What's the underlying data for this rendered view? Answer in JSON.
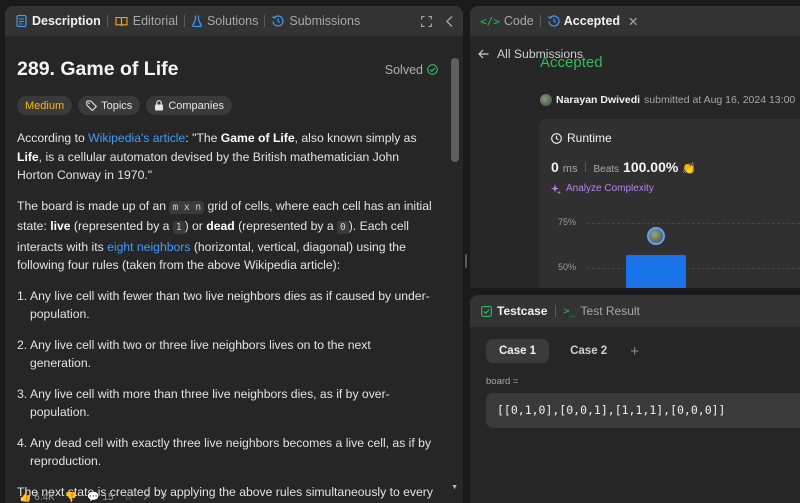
{
  "left_tabs": {
    "description": "Description",
    "editorial": "Editorial",
    "solutions": "Solutions",
    "submissions": "Submissions"
  },
  "problem": {
    "title": "289. Game of Life",
    "solved_label": "Solved",
    "difficulty": "Medium",
    "topics": "Topics",
    "companies": "Companies"
  },
  "description": {
    "p1_a": "According to ",
    "p1_link": "Wikipedia's article",
    "p1_b": ": \"The ",
    "p1_bold1": "Game of Life",
    "p1_c": ", also known simply as ",
    "p1_bold2": "Life",
    "p1_d": ", is a cellular automaton devised by the British mathematician John Horton Conway in 1970.\"",
    "p2_a": "The board is made up of an ",
    "p2_code": "m x n",
    "p2_b": " grid of cells, where each cell has an initial state: ",
    "p2_live": "live",
    "p2_c": " (represented by a ",
    "p2_one": "1",
    "p2_d": ") or ",
    "p2_dead": "dead",
    "p2_e": " (represented by a ",
    "p2_zero": "0",
    "p2_f": "). Each cell interacts with its ",
    "p2_link": "eight neighbors",
    "p2_g": " (horizontal, vertical, diagonal) using the following four rules (taken from the above Wikipedia article):",
    "rules": [
      {
        "num": "1.",
        "text": "Any live cell with fewer than two live neighbors dies as if caused by under-population."
      },
      {
        "num": "2.",
        "text": "Any live cell with two or three live neighbors lives on to the next generation."
      },
      {
        "num": "3.",
        "text": "Any live cell with more than three live neighbors dies, as if by over-population."
      },
      {
        "num": "4.",
        "text": "Any dead cell with exactly three live neighbors becomes a live cell, as if by reproduction."
      }
    ],
    "p3": "The next state is created by applying the above rules simultaneously to every cell in the current state, where births and deaths occur simultaneously. Given"
  },
  "bottom_bar": {
    "likes": "6.4K",
    "comments": "15"
  },
  "right_tabs": {
    "code": "Code",
    "accepted": "Accepted"
  },
  "submission": {
    "back_label": "All Submissions",
    "status": "Accepted",
    "user": "Narayan Dwivedi",
    "submitted_text": "submitted at Aug 16, 2024 13:00",
    "runtime_label": "Runtime",
    "runtime_value": "0",
    "runtime_unit": "ms",
    "beats_label": "Beats",
    "beats_value": "100.00%",
    "analyze_label": "Analyze Complexity"
  },
  "chart_data": {
    "type": "bar",
    "ytick_labels": [
      "75%",
      "50%"
    ],
    "yticks": [
      75,
      50
    ],
    "values": [
      50
    ]
  },
  "testcase": {
    "tab_testcase": "Testcase",
    "tab_result": "Test Result",
    "cases": [
      "Case 1",
      "Case 2"
    ],
    "var_name": "board =",
    "var_value": "[[0,1,0],[0,0,1],[1,1,1],[0,0,0]]"
  },
  "colors": {
    "accent_green": "#2cbb5d",
    "accent_blue": "#3c9cff",
    "medium_yellow": "#ffb800",
    "bar_blue": "#1a73e8"
  }
}
